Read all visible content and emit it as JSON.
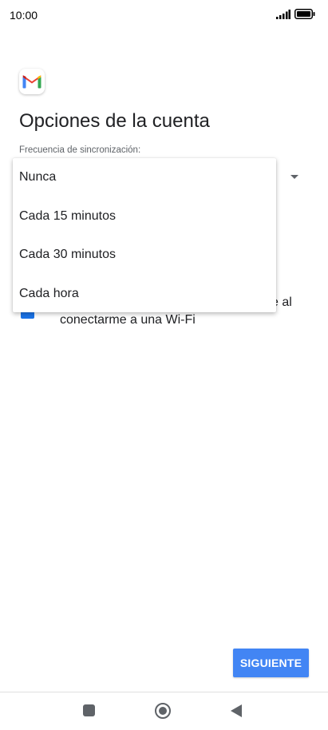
{
  "status_bar": {
    "time": "10:00"
  },
  "icons": {
    "app": "gmail-logo-icon",
    "signal": "signal-icon",
    "battery": "battery-icon"
  },
  "page": {
    "title": "Opciones de la cuenta",
    "sync_label": "Frecuencia de sincronización:"
  },
  "dropdown": {
    "options": [
      "Nunca",
      "Cada 15 minutos",
      "Cada 30 minutos",
      "Cada hora"
    ]
  },
  "wifi_option": {
    "text_visible_tail": "e al",
    "text_line2": "conectarme a una Wi-Fi",
    "checked": true
  },
  "actions": {
    "next_label": "SIGUIENTE"
  },
  "colors": {
    "accent": "#4285f4",
    "checkbox": "#1a73e8",
    "nav_icons": "#5f6368"
  }
}
